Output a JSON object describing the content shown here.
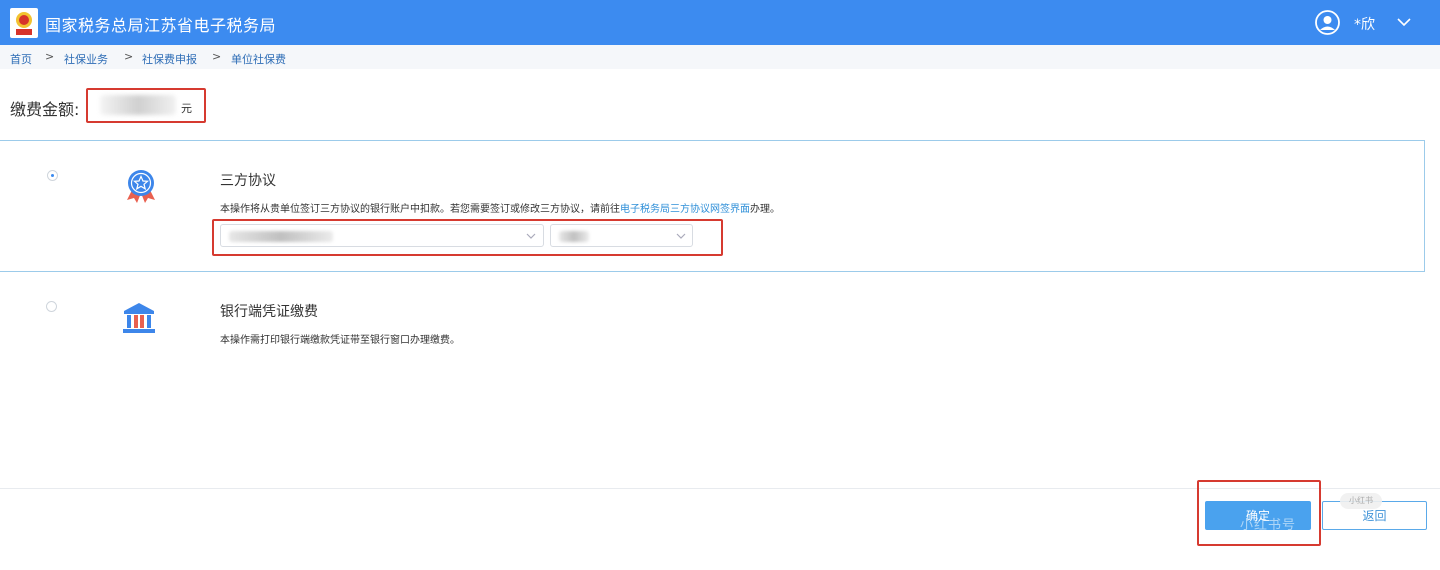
{
  "header": {
    "title": "国家税务总局江苏省电子税务局",
    "user_name": "*欣",
    "logo_icon": "tax-emblem-icon",
    "accent": "#3c8bf0"
  },
  "breadcrumb": [
    "首页",
    "社保业务",
    "社保费申报",
    "单位社保费"
  ],
  "amount": {
    "label": "缴费金额:",
    "unit": "元"
  },
  "payment_options": [
    {
      "title": "三方协议",
      "selected": true,
      "icon": "award-badge-icon",
      "desc_before": "本操作将从贵单位签订三方协议的银行账户中扣款。若您需要签订或修改三方协议，请前往",
      "desc_link": "电子税务局三方协议网签界面",
      "desc_after": "办理。"
    },
    {
      "title": "银行端凭证缴费",
      "selected": false,
      "icon": "bank-building-icon",
      "desc": "本操作需打印银行端缴款凭证带至银行窗口办理缴费。"
    }
  ],
  "actions": {
    "confirm": "确定",
    "back": "返回"
  },
  "watermark": {
    "text": "小红书号",
    "badge": "小红书"
  }
}
